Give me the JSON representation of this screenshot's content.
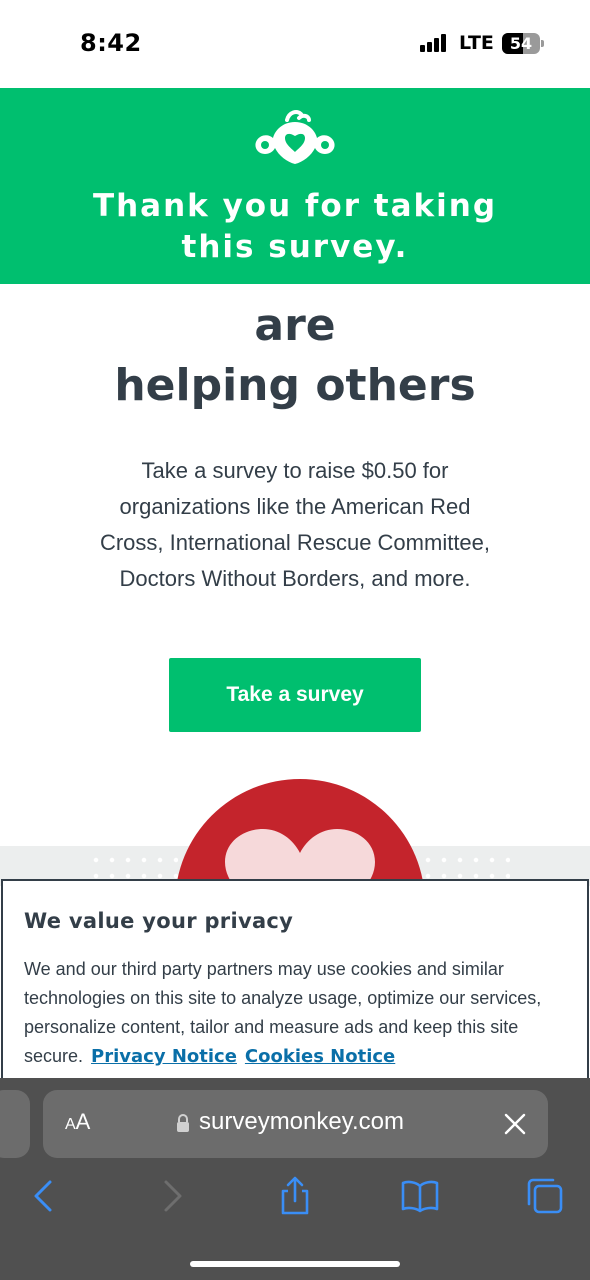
{
  "status_bar": {
    "time": "8:42",
    "network": "LTE",
    "battery_level": "54",
    "battery_fraction": 0.54
  },
  "banner": {
    "logo_icon": "surveymonkey-logo-icon",
    "message_line1": "Thank you for taking",
    "message_line2": "this survey."
  },
  "hero": {
    "headline_line1": "are",
    "headline_line2": "helping others",
    "body_line1": "Take a survey to raise $0.50 for",
    "body_line2": "organizations like the American Red",
    "body_line3": "Cross, International Rescue Committee,",
    "body_line4": "Doctors Without Borders, and more.",
    "cta_label": "Take a survey"
  },
  "privacy": {
    "title": "We value your privacy",
    "body": "We and our third party partners may use cookies and similar technologies on this site to analyze usage, optimize our services, personalize content, tailor and measure ads and keep this site secure.",
    "privacy_link": "Privacy Notice",
    "cookies_link": "Cookies Notice"
  },
  "browser": {
    "text_size_label_small": "A",
    "text_size_label_large": "A",
    "url": "surveymonkey.com",
    "toolbar_icons": [
      "back-icon",
      "forward-icon",
      "share-icon",
      "bookmarks-icon",
      "tabs-icon"
    ]
  },
  "colors": {
    "brand_green": "#00bf6f",
    "text_dark": "#333e48",
    "link_blue": "#0a6fa8",
    "safari_bar": "#505050",
    "ios_blue": "#3a8ef6"
  }
}
